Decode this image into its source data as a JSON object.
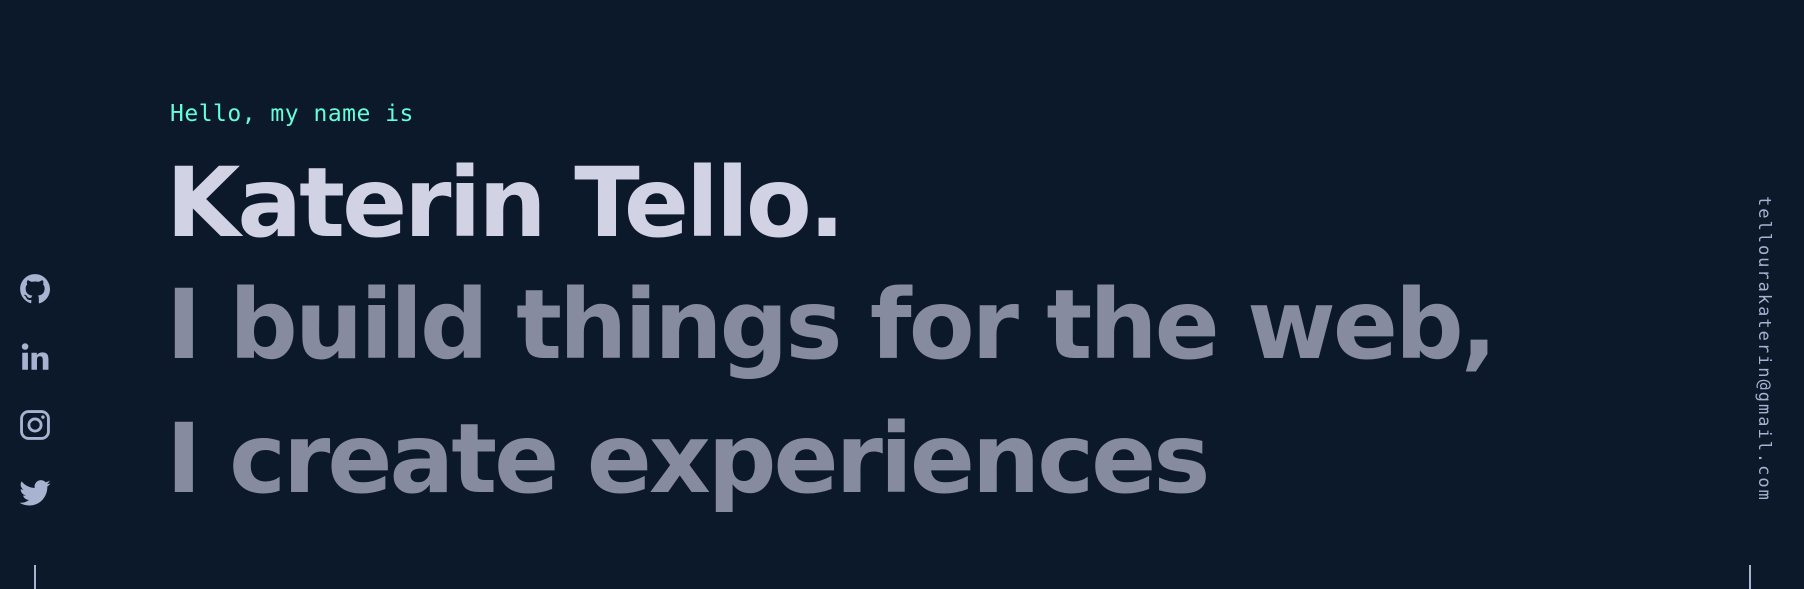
{
  "hero": {
    "greeting": "Hello, my name is",
    "name": "Katerin Tello.",
    "tagline": "I build things for the web, I create experiences"
  },
  "social": {
    "items": [
      {
        "icon": "github-icon",
        "label": "GitHub"
      },
      {
        "icon": "linkedin-icon",
        "label": "LinkedIn"
      },
      {
        "icon": "instagram-icon",
        "label": "Instagram"
      },
      {
        "icon": "twitter-icon",
        "label": "Twitter"
      }
    ]
  },
  "email": "tellourakaterin@gmail.com",
  "colors": {
    "background": "#0b192a",
    "accent": "#64ffda",
    "name": "#d1d3e4",
    "tagline": "#878ba0",
    "rail": "#a8b2d1"
  }
}
